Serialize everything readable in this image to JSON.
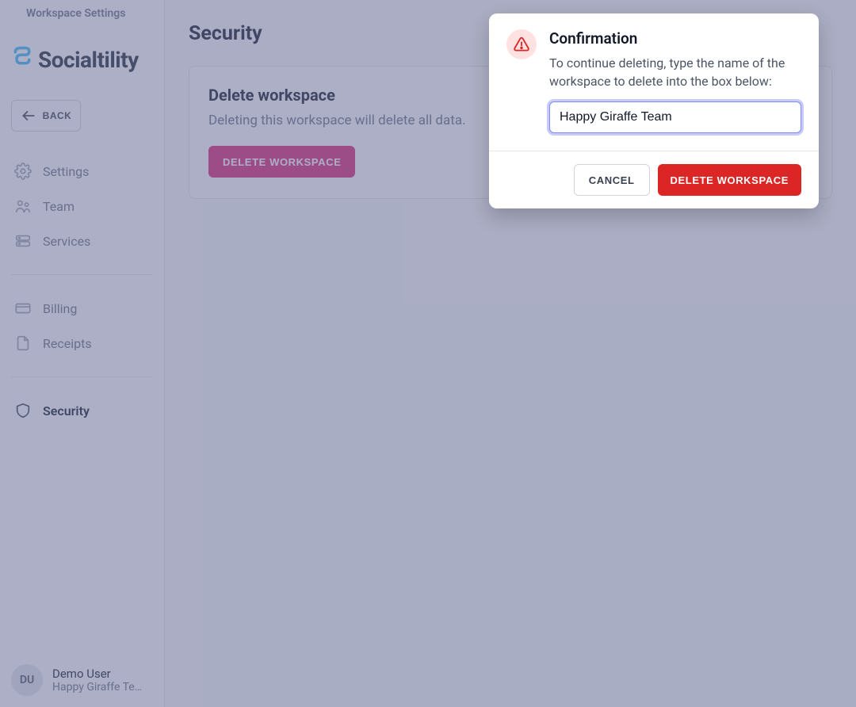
{
  "header": {
    "label": "Workspace Settings"
  },
  "brand": {
    "name": "Socialtility"
  },
  "back": {
    "label": "BACK"
  },
  "sidebar": {
    "items": [
      {
        "label": "Settings"
      },
      {
        "label": "Team"
      },
      {
        "label": "Services"
      },
      {
        "label": "Billing"
      },
      {
        "label": "Receipts"
      },
      {
        "label": "Security"
      }
    ]
  },
  "user": {
    "initials": "DU",
    "name": "Demo User",
    "team": "Happy Giraffe Te…"
  },
  "page": {
    "title": "Security",
    "card": {
      "title": "Delete workspace",
      "desc": "Deleting this workspace will delete all data.",
      "button": "DELETE WORKSPACE"
    }
  },
  "modal": {
    "title": "Confirmation",
    "text": "To continue deleting, type the name of the workspace to delete into the box below:",
    "input_value": "Happy Giraffe Team",
    "cancel": "CANCEL",
    "confirm": "DELETE WORKSPACE"
  }
}
